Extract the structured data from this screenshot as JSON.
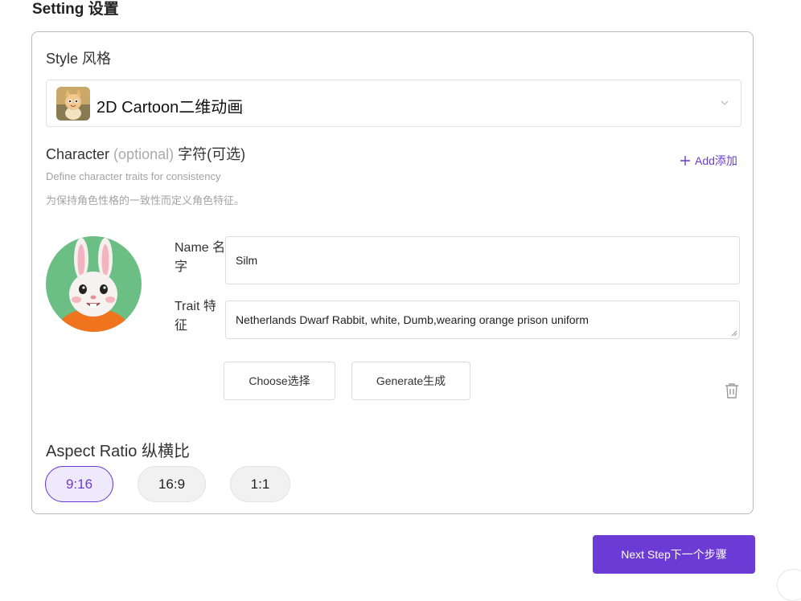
{
  "page": {
    "title": "Setting 设置"
  },
  "style": {
    "label": "Style 风格",
    "selected": "2D Cartoon二维动画",
    "thumb_icon": "cartoon-cat-thumbnail"
  },
  "character": {
    "label": "Character",
    "optional": "(optional)",
    "label_cn": "字符(可选)",
    "add_label": "Add添加",
    "hint_en": "Define character traits for consistency",
    "hint_cn": "为保持角色性格的一致性而定义角色特征。",
    "name_label": "Name 名字",
    "name_value": "Silm",
    "trait_label": "Trait 特征",
    "trait_value": "Netherlands Dwarf Rabbit, white, Dumb,wearing orange prison uniform",
    "choose_label": "Choose选择",
    "generate_label": "Generate生成"
  },
  "aspect": {
    "label": "Aspect Ratio 纵横比",
    "options": [
      "9:16",
      "16:9",
      "1:1"
    ],
    "selected": "9:16"
  },
  "footer": {
    "next_label": "Next Step下一个步骤"
  },
  "colors": {
    "accent": "#6c3bd5",
    "selected_bg": "#efe9fc",
    "pill_bg": "#f1f1f1"
  }
}
